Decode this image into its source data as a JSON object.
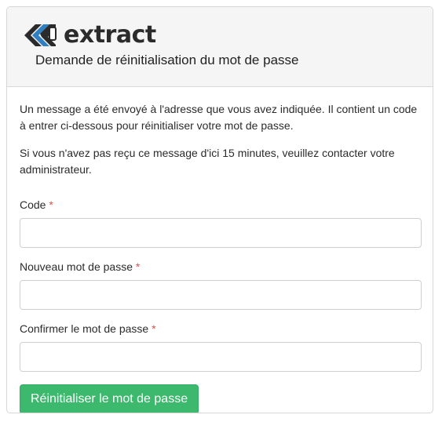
{
  "header": {
    "logo_text": "extract",
    "title": "Demande de réinitialisation du mot de passe"
  },
  "body": {
    "message_1": "Un message a été envoyé à l'adresse que vous avez indiquée. Il contient un code à entrer ci-dessous pour réinitialiser votre mot de passe.",
    "message_2": "Si vous n'avez pas reçu ce message d'ici 15 minutes, veuillez contacter votre administrateur."
  },
  "form": {
    "required_marker": "*",
    "code": {
      "label": "Code",
      "value": ""
    },
    "new_password": {
      "label": "Nouveau mot de passe",
      "value": ""
    },
    "confirm_password": {
      "label": "Confirmer le mot de passe",
      "value": ""
    },
    "submit_label": "Réinitialiser le mot de passe"
  },
  "colors": {
    "accent": "#3cb96d",
    "required": "#d9534f",
    "logo_blue": "#2f7fc1",
    "logo_dark": "#2b2b2b"
  },
  "icons": {
    "logo": "extract-logo-icon"
  }
}
